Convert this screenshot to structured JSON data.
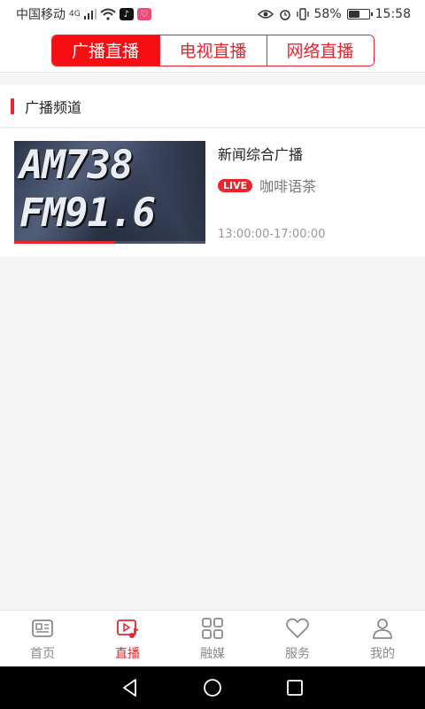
{
  "status_bar": {
    "carrier": "中国移动",
    "network": "4G",
    "battery": "58%",
    "battery_level": 0.58,
    "time": "15:58"
  },
  "tabs": [
    {
      "label": "广播直播",
      "active": true
    },
    {
      "label": "电视直播",
      "active": false
    },
    {
      "label": "网络直播",
      "active": false
    }
  ],
  "section": {
    "title": "广播频道"
  },
  "channels": [
    {
      "thumbnail_line1": "AM738",
      "thumbnail_line2": "FM91.6",
      "name": "新闻综合广播",
      "live_badge": "LIVE",
      "program": "咖啡语茶",
      "time": "13:00:00-17:00:00"
    }
  ],
  "bottom_nav": [
    {
      "label": "首页",
      "icon": "news-icon",
      "active": false
    },
    {
      "label": "直播",
      "icon": "live-play-icon",
      "active": true
    },
    {
      "label": "融媒",
      "icon": "grid-icon",
      "active": false
    },
    {
      "label": "服务",
      "icon": "heart-icon",
      "active": false
    },
    {
      "label": "我的",
      "icon": "user-icon",
      "active": false
    }
  ],
  "colors": {
    "accent": "#e8262d",
    "active_tab_bg": "#f70e12",
    "background": "#f5f5f5"
  }
}
